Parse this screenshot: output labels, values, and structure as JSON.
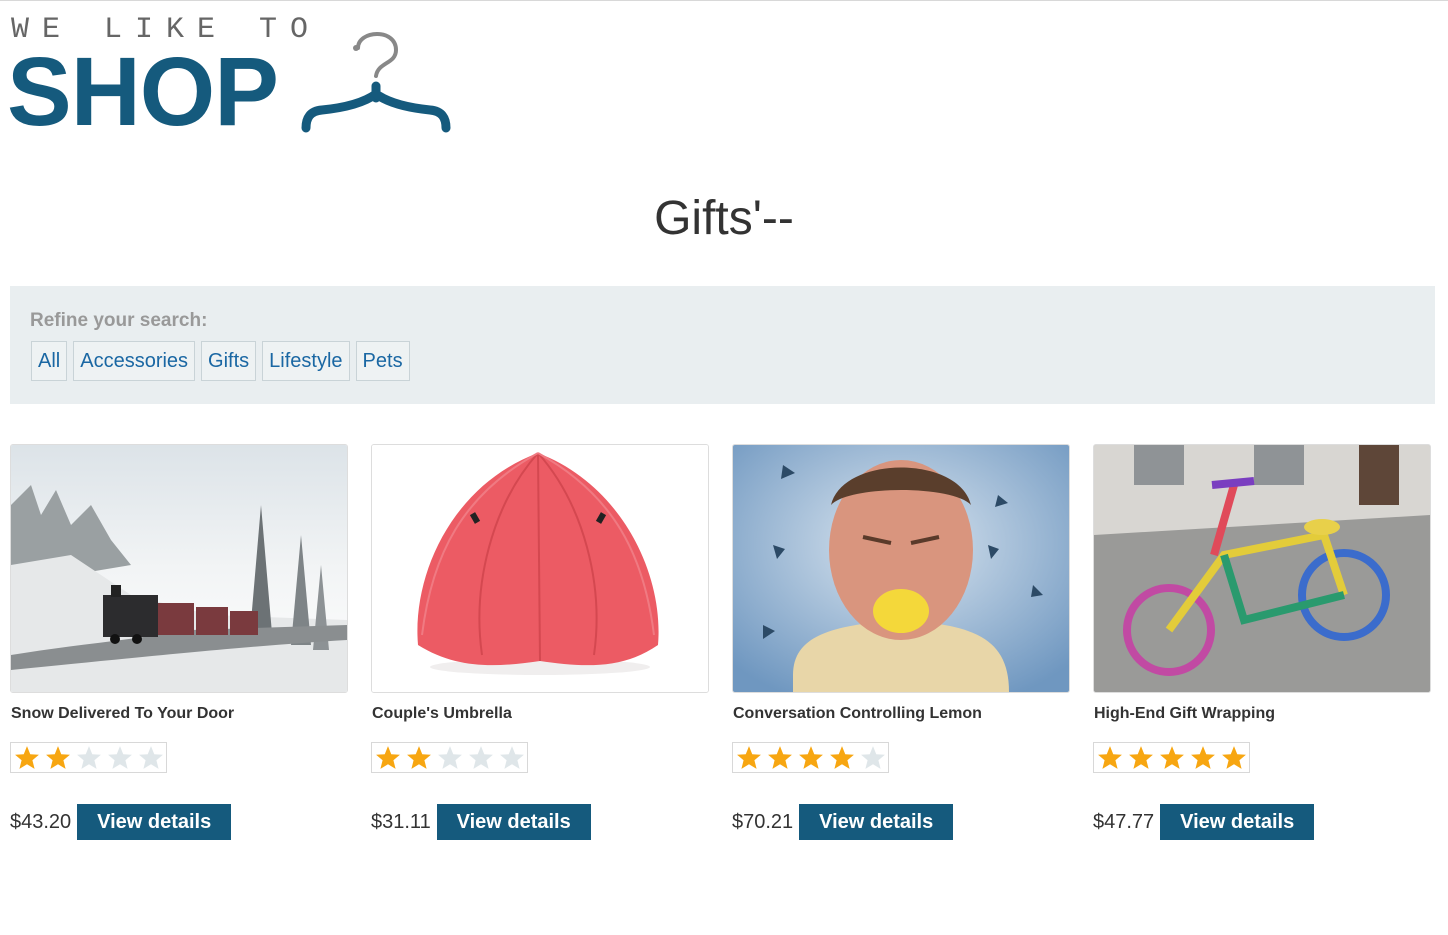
{
  "logo": {
    "top_text": "WE LIKE TO",
    "main_text": "SHOP",
    "icon": "hanger-icon"
  },
  "page": {
    "title": "Gifts'--"
  },
  "filter": {
    "label": "Refine your search:",
    "links": [
      "All",
      "Accessories",
      "Gifts",
      "Lifestyle",
      "Pets"
    ]
  },
  "products": [
    {
      "name": "Snow Delivered To Your Door",
      "rating": 2,
      "price": "$43.20",
      "button": "View details"
    },
    {
      "name": "Couple's Umbrella",
      "rating": 2,
      "price": "$31.11",
      "button": "View details"
    },
    {
      "name": "Conversation Controlling Lemon",
      "rating": 4,
      "price": "$70.21",
      "button": "View details"
    },
    {
      "name": "High-End Gift Wrapping",
      "rating": 5,
      "price": "$47.77",
      "button": "View details"
    }
  ],
  "colors": {
    "brand": "#155a7d",
    "link": "#1a67a3",
    "star_on": "#f7a611",
    "star_off": "#dfe6e9",
    "filter_bg": "#e9eef0"
  }
}
